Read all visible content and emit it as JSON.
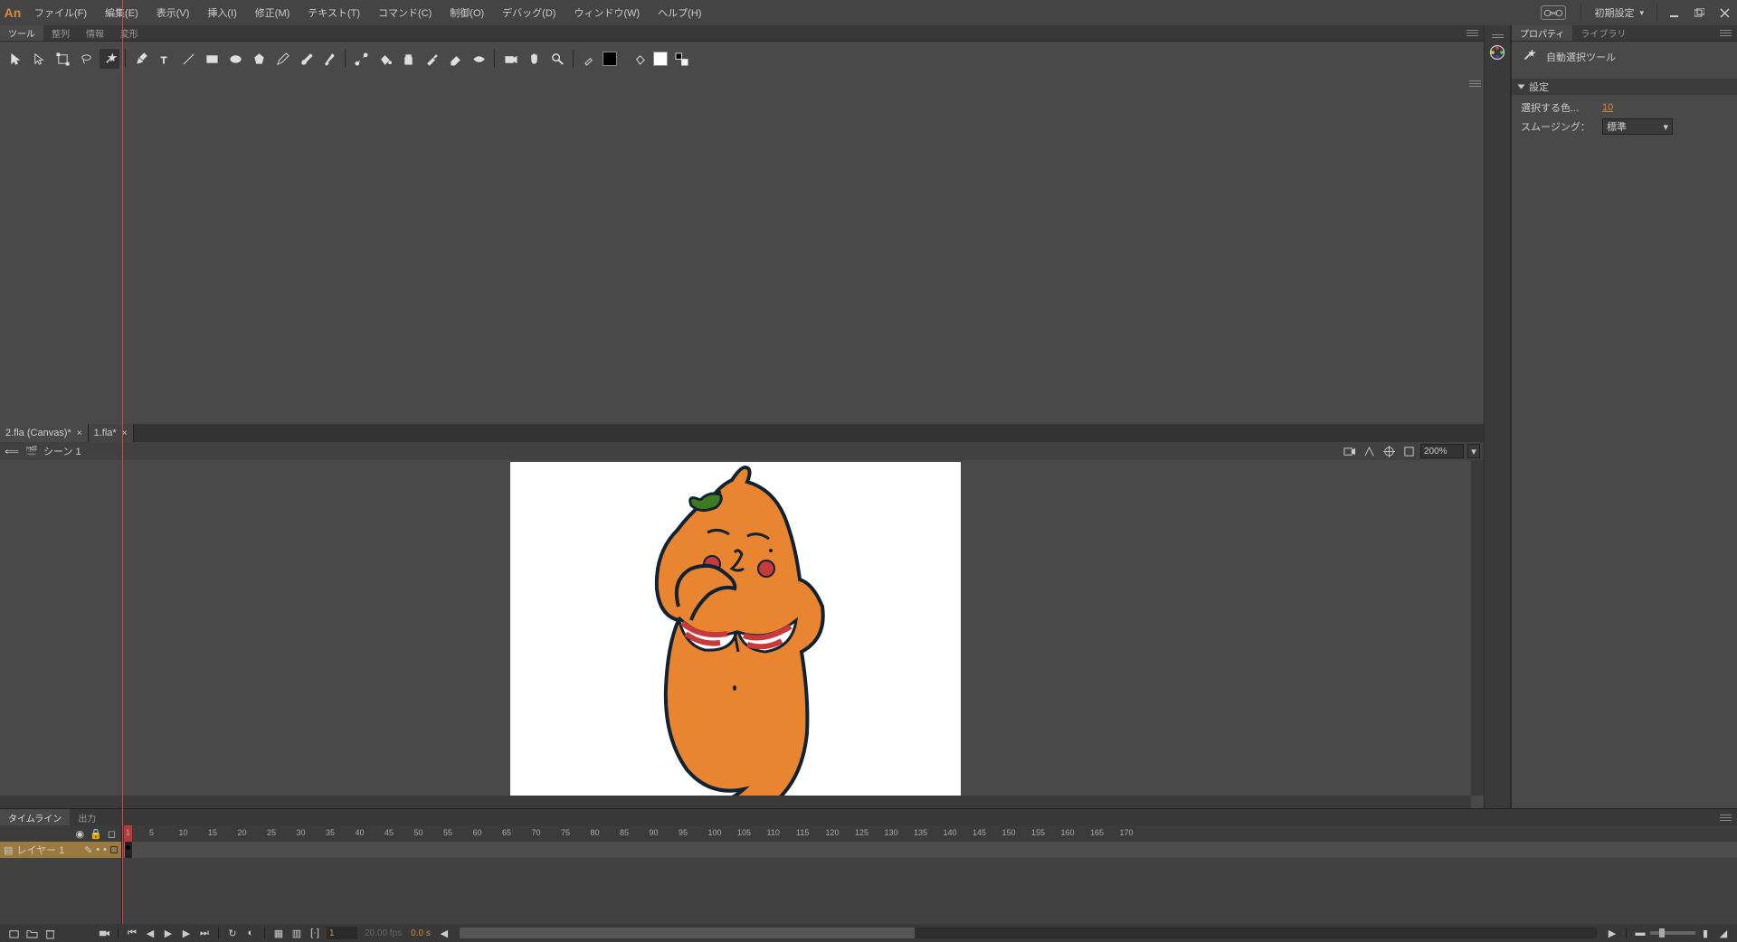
{
  "app": {
    "logo": "An"
  },
  "menu": {
    "file": "ファイル(F)",
    "edit": "編集(E)",
    "view": "表示(V)",
    "insert": "挿入(I)",
    "modify": "修正(M)",
    "text": "テキスト(T)",
    "commands": "コマンド(C)",
    "control": "制御(O)",
    "debug": "デバッグ(D)",
    "window": "ウィンドウ(W)",
    "help": "ヘルプ(H)"
  },
  "title_right": {
    "workspace": "初期設定",
    "dropdown": "▾"
  },
  "tool_panel": {
    "tools": "ツール",
    "align": "整列",
    "info": "情報",
    "transform": "変形"
  },
  "docs": {
    "tab1": "2.fla (Canvas)*",
    "tab2": "1.fla*"
  },
  "scene": {
    "back": "⟸",
    "icon": "🎬",
    "name": "シーン 1",
    "zoom": "200%"
  },
  "right_panel": {
    "properties": "プロパティ",
    "library": "ライブラリ",
    "tool_name": "自動選択ツール",
    "settings_title": "設定",
    "colors_label": "選択する色...",
    "colors_value": "10",
    "smoothing_label": "スムージング：",
    "smoothing_value": "標準"
  },
  "timeline": {
    "tab_timeline": "タイムライン",
    "tab_output": "出力",
    "layer1": "レイヤー 1",
    "frame": "1",
    "fps": "20.00 fps",
    "time": "0.0 s",
    "ticks": [
      "1",
      "5",
      "10",
      "15",
      "20",
      "25",
      "30",
      "35",
      "40",
      "45",
      "50",
      "55",
      "60",
      "65",
      "70",
      "75",
      "80",
      "85",
      "90",
      "95",
      "100",
      "105",
      "110",
      "115",
      "120",
      "125",
      "130",
      "135",
      "140",
      "145",
      "150",
      "155",
      "160",
      "165",
      "170"
    ]
  }
}
